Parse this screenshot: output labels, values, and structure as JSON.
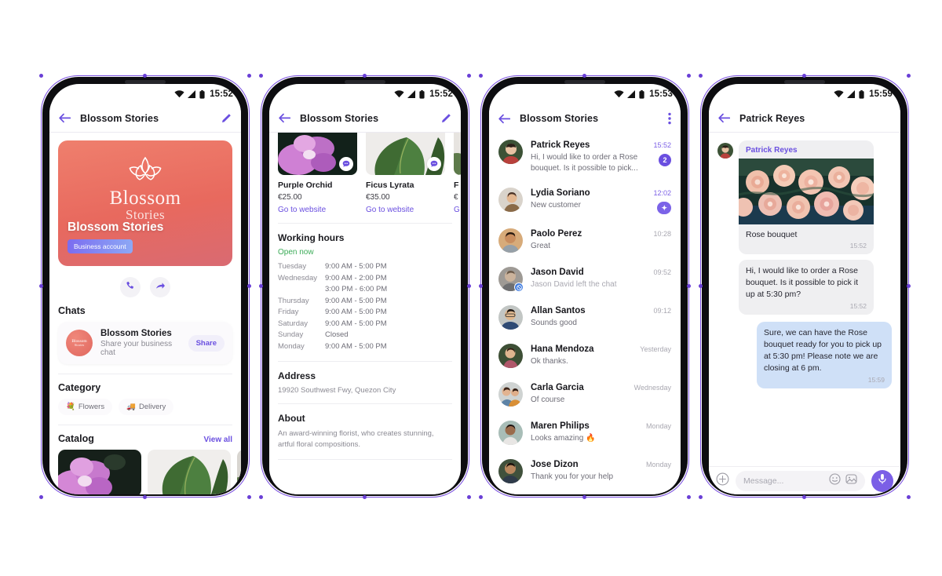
{
  "meta": {
    "app": "Viber Business Messenger mockup",
    "accent": "#6a4fe0",
    "frame_outline": "#7a4fe0",
    "hero_gradient_from": "#ef7f6d",
    "hero_gradient_to": "#d96a72",
    "outgoing_bubble": "#cfe0f7",
    "incoming_bubble": "#efeff1"
  },
  "phone1": {
    "status": {
      "time": "15:52",
      "wifi_icon": "wifi-icon",
      "signal_icon": "signal-icon",
      "battery_icon": "battery-icon"
    },
    "appbar": {
      "back_icon": "back-arrow-icon",
      "title": "Blossom Stories",
      "action_icon": "edit-pencil-icon"
    },
    "hero": {
      "logo_icon": "lotus-flower-logo",
      "logo_line1": "Blossom",
      "logo_line2": "Stories",
      "business_name": "Blossom Stories",
      "badge": "Business account"
    },
    "actions": [
      {
        "name": "call-button",
        "icon": "phone-icon"
      },
      {
        "name": "share-button",
        "icon": "forward-arrow-icon"
      }
    ],
    "chats": {
      "heading": "Chats",
      "card": {
        "avatar_line1": "Blossom",
        "avatar_line2": "Stories",
        "title": "Blossom Stories",
        "subtitle": "Share your business chat",
        "button": "Share"
      }
    },
    "category": {
      "heading": "Category",
      "chips": [
        {
          "icon": "bouquet-emoji",
          "glyph": "💐",
          "label": "Flowers"
        },
        {
          "icon": "truck-emoji",
          "glyph": "🚚",
          "label": "Delivery"
        }
      ]
    },
    "catalog": {
      "heading": "Catalog",
      "view_all": "View all",
      "items": [
        {
          "name": "purple-orchid-thumb",
          "alt": "Purple orchid blossoms on dark background"
        },
        {
          "name": "ficus-lyrata-thumb",
          "alt": "Ficus lyrata green leaves"
        },
        {
          "name": "third-thumb-partial",
          "alt": "Third catalog item, cropped"
        }
      ]
    }
  },
  "phone2": {
    "status": {
      "time": "15:52"
    },
    "appbar": {
      "back_icon": "back-arrow-icon",
      "title": "Blossom Stories",
      "action_icon": "edit-pencil-icon"
    },
    "products": [
      {
        "name": "Purple Orchid",
        "price": "€25.00",
        "link": "Go to website",
        "chat_icon": "chat-bubble-icon",
        "alt": "Purple orchid"
      },
      {
        "name": "Ficus Lyrata",
        "price": "€35.00",
        "link": "Go to website",
        "chat_icon": "chat-bubble-icon",
        "alt": "Ficus lyrata leaves"
      },
      {
        "name": "F",
        "price": "€",
        "link": "G",
        "chat_icon": "chat-bubble-icon",
        "alt": "cropped third product"
      }
    ],
    "working_hours": {
      "heading": "Working hours",
      "status": "Open now",
      "rows": [
        {
          "day": "Tuesday",
          "hours": "9:00 AM - 5:00 PM"
        },
        {
          "day": "Wednesday",
          "hours": "9:00 AM - 2:00 PM"
        },
        {
          "day": "",
          "hours": "3:00 PM - 6:00 PM"
        },
        {
          "day": "Thursday",
          "hours": "9:00 AM - 5:00 PM"
        },
        {
          "day": "Friday",
          "hours": "9:00 AM - 5:00 PM"
        },
        {
          "day": "Saturday",
          "hours": "9:00 AM - 5:00 PM"
        },
        {
          "day": "Sunday",
          "hours": "Closed"
        },
        {
          "day": "Monday",
          "hours": "9:00 AM - 5:00 PM"
        }
      ]
    },
    "address": {
      "heading": "Address",
      "value": "19920 Southwest Fwy, Quezon City"
    },
    "about": {
      "heading": "About",
      "value": "An award-winning florist, who creates stunning, artful floral compositions."
    }
  },
  "phone3": {
    "status": {
      "time": "15:53"
    },
    "appbar": {
      "back_icon": "back-arrow-icon",
      "title": "Blossom Stories",
      "action_icon": "more-vertical-icon"
    },
    "conversations": [
      {
        "name": "Patrick Reyes",
        "preview": "Hi, I would like to order a Rose bouquet. Is it possible to pick...",
        "time": "15:52",
        "unread": true,
        "badge": "2",
        "badge_type": "count",
        "avatar": "avatar-patrick-reyes"
      },
      {
        "name": "Lydia Soriano",
        "preview": "New customer",
        "time": "12:02",
        "unread": true,
        "badge": "✦",
        "badge_type": "star",
        "avatar": "avatar-lydia-soriano"
      },
      {
        "name": "Paolo Perez",
        "preview": "Great",
        "time": "10:28",
        "unread": false,
        "badge": "",
        "badge_type": "none",
        "avatar": "avatar-paolo-perez"
      },
      {
        "name": "Jason David",
        "preview": "Jason David left the chat",
        "time": "09:52",
        "unread": false,
        "badge": "",
        "badge_type": "none",
        "avatar": "avatar-jason-david",
        "muted": true,
        "status_icon": "left-chat-icon"
      },
      {
        "name": "Allan Santos",
        "preview": "Sounds good",
        "time": "09:12",
        "unread": false,
        "badge": "",
        "badge_type": "none",
        "avatar": "avatar-allan-santos"
      },
      {
        "name": "Hana Mendoza",
        "preview": "Ok thanks.",
        "time": "Yesterday",
        "unread": false,
        "badge": "",
        "badge_type": "none",
        "avatar": "avatar-hana-mendoza"
      },
      {
        "name": "Carla Garcia",
        "preview": "Of course",
        "time": "Wednesday",
        "unread": false,
        "badge": "",
        "badge_type": "none",
        "avatar": "avatar-carla-garcia"
      },
      {
        "name": "Maren Philips",
        "preview": "Looks amazing 🔥",
        "time": "Monday",
        "unread": false,
        "badge": "",
        "badge_type": "none",
        "avatar": "avatar-maren-philips"
      },
      {
        "name": "Jose Dizon",
        "preview": "Thank you for your help",
        "time": "Monday",
        "unread": false,
        "badge": "",
        "badge_type": "none",
        "avatar": "avatar-jose-dizon"
      }
    ]
  },
  "phone4": {
    "status": {
      "time": "15:59"
    },
    "appbar": {
      "back_icon": "back-arrow-icon",
      "title": "Patrick Reyes"
    },
    "messages": [
      {
        "kind": "incoming-media",
        "sender": "Patrick Reyes",
        "image_alt": "Pale pink rose bouquet",
        "caption": "Rose bouquet",
        "time": "15:52"
      },
      {
        "kind": "incoming",
        "text": "Hi, I would like to order a Rose bouquet. Is it possible to pick it up at 5:30 pm?",
        "time": "15:52"
      },
      {
        "kind": "outgoing",
        "text": "Sure, we can have the Rose bouquet ready for you to pick up at 5:30 pm! Please note we are closing at 6 pm.",
        "time": "15:59"
      }
    ],
    "composer": {
      "plus_icon": "plus-circle-icon",
      "placeholder": "Message...",
      "emoji_icon": "smiley-icon",
      "sticker_icon": "sticker-icon",
      "mic_icon": "microphone-icon"
    }
  }
}
